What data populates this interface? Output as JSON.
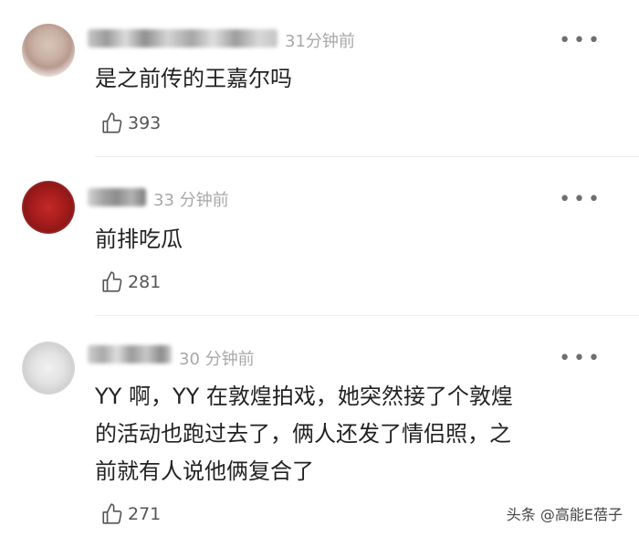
{
  "comments": [
    {
      "time": "31分钟前",
      "text_lines": [
        "是之前传的王嘉尔吗"
      ],
      "likes": "393",
      "more": "•••"
    },
    {
      "time": "33 分钟前",
      "text_lines": [
        "前排吃瓜"
      ],
      "likes": "281",
      "more": "•••"
    },
    {
      "time": "30 分钟前",
      "text_lines": [
        "YY 啊，YY 在敦煌拍戏，她突然接了个敦煌",
        "的活动也跑过去了，俩人还发了情侣照，之",
        "前就有人说他俩复合了"
      ],
      "likes": "271",
      "more": "•••"
    }
  ],
  "watermark": "头条 @高能E蓓子"
}
